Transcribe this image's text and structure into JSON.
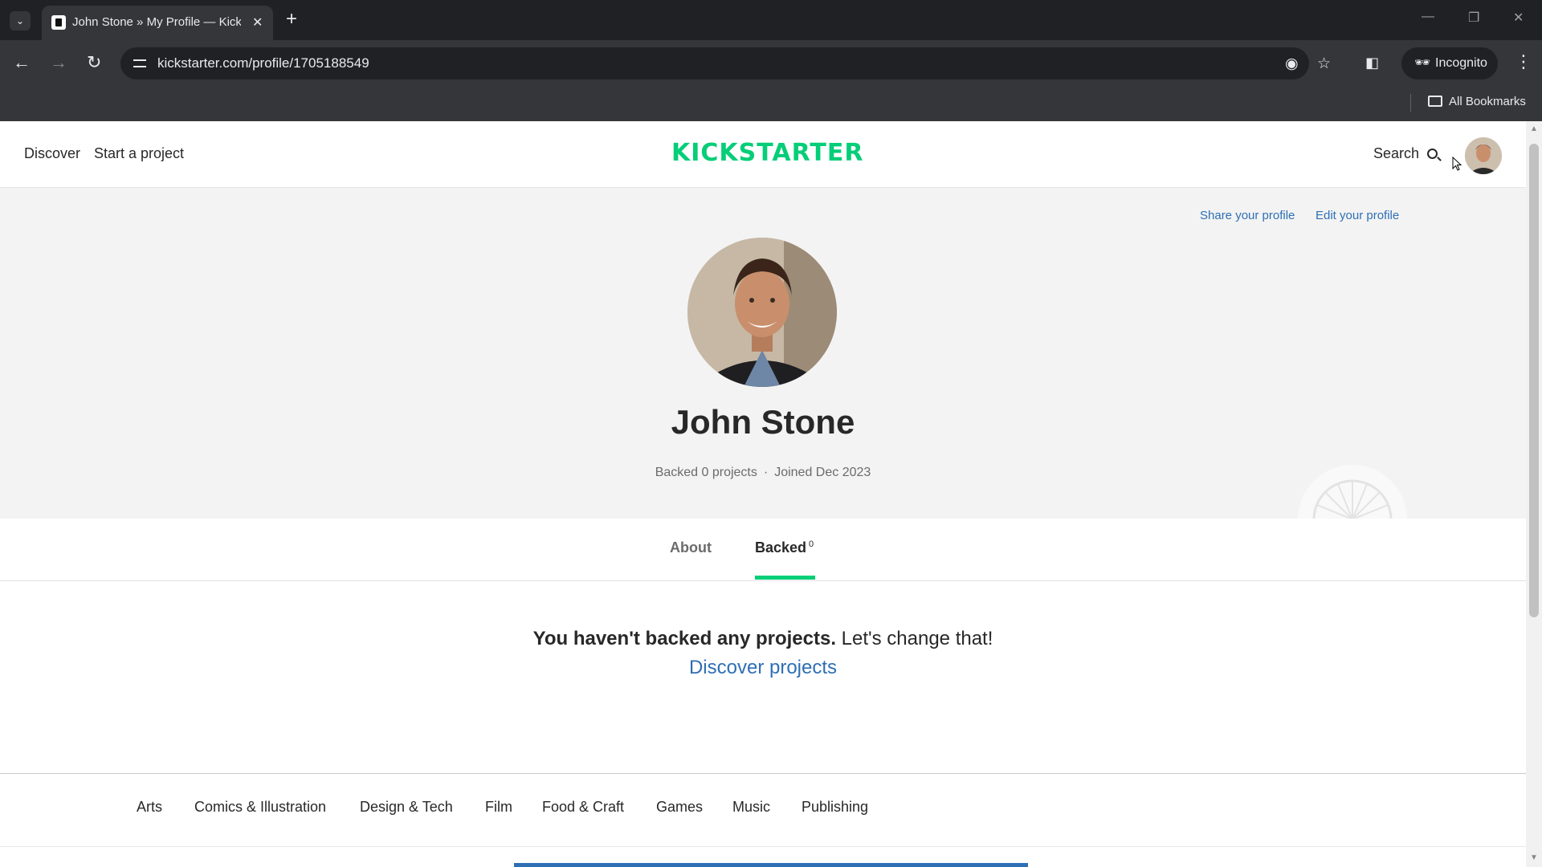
{
  "browser": {
    "tab_title": "John Stone » My Profile — Kickstarter",
    "tab_close": "✕",
    "new_tab": "+",
    "tab_menu": "⌄",
    "url": "kickstarter.com/profile/1705188549",
    "incognito_label": "Incognito",
    "bookmarks_label": "All Bookmarks"
  },
  "header": {
    "discover": "Discover",
    "start_project": "Start a project",
    "logo_text": "KICKSTARTER",
    "logo_color": "#05ce78",
    "search": "Search"
  },
  "profile": {
    "share": "Share your profile",
    "edit": "Edit your profile",
    "name": "John Stone",
    "backed_count_text": "Backed 0 projects",
    "meta_separator": "·",
    "joined": "Joined Dec 2023"
  },
  "tabs": {
    "about": "About",
    "backed": "Backed",
    "backed_count": "0"
  },
  "empty_state": {
    "bold": "You haven't backed any projects.",
    "rest": " Let's change that!",
    "link": "Discover projects"
  },
  "categories": [
    "Arts",
    "Comics & Illustration",
    "Design & Tech",
    "Film",
    "Food & Craft",
    "Games",
    "Music",
    "Publishing"
  ],
  "colors": {
    "brand_green": "#05ce78",
    "link_blue": "#2e6fb5",
    "chrome_dark": "#202124",
    "chrome_toolbar": "#35363a",
    "profile_band": "#f3f3f3"
  }
}
